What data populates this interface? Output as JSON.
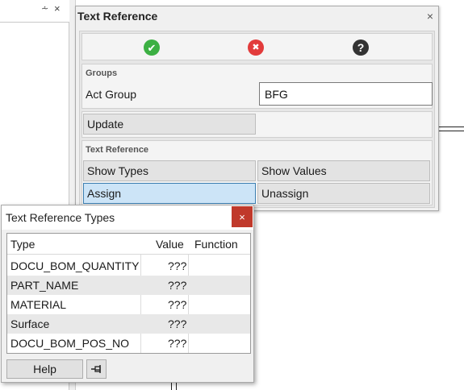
{
  "background": {
    "pin_glyph": "⩪",
    "close_glyph": "×"
  },
  "text_reference_panel": {
    "title": "Text Reference",
    "close_glyph": "×",
    "actions": {
      "ok_icon": "check-icon",
      "cancel_icon": "cancel-icon",
      "help_icon": "question-icon",
      "ok_glyph": "✔",
      "cancel_glyph": "✖",
      "help_glyph": "?",
      "colors": {
        "ok": "#3cb043",
        "cancel": "#e23b3b",
        "help": "#333333"
      }
    },
    "groups": {
      "label": "Groups",
      "act_group_label": "Act Group",
      "act_group_value": "BFG",
      "update_label": "Update"
    },
    "text_reference": {
      "label": "Text Reference",
      "show_types_label": "Show Types",
      "show_values_label": "Show Values",
      "assign_label": "Assign",
      "unassign_label": "Unassign"
    }
  },
  "types_dialog": {
    "title": "Text Reference Types",
    "close_glyph": "×",
    "columns": [
      "Type",
      "Value",
      "Function"
    ],
    "rows": [
      {
        "type": "DOCU_BOM_QUANTITY",
        "value": "???",
        "function": ""
      },
      {
        "type": "PART_NAME",
        "value": "???",
        "function": ""
      },
      {
        "type": "MATERIAL",
        "value": "???",
        "function": ""
      },
      {
        "type": "Surface",
        "value": "???",
        "function": ""
      },
      {
        "type": "DOCU_BOM_POS_NO",
        "value": "???",
        "function": ""
      }
    ],
    "help_label": "Help",
    "pin_icon": "pin-icon",
    "colors": {
      "close_button": "#c0392b",
      "alt_row": "#e8e8e8",
      "selected_button": "#cce4f7"
    }
  }
}
